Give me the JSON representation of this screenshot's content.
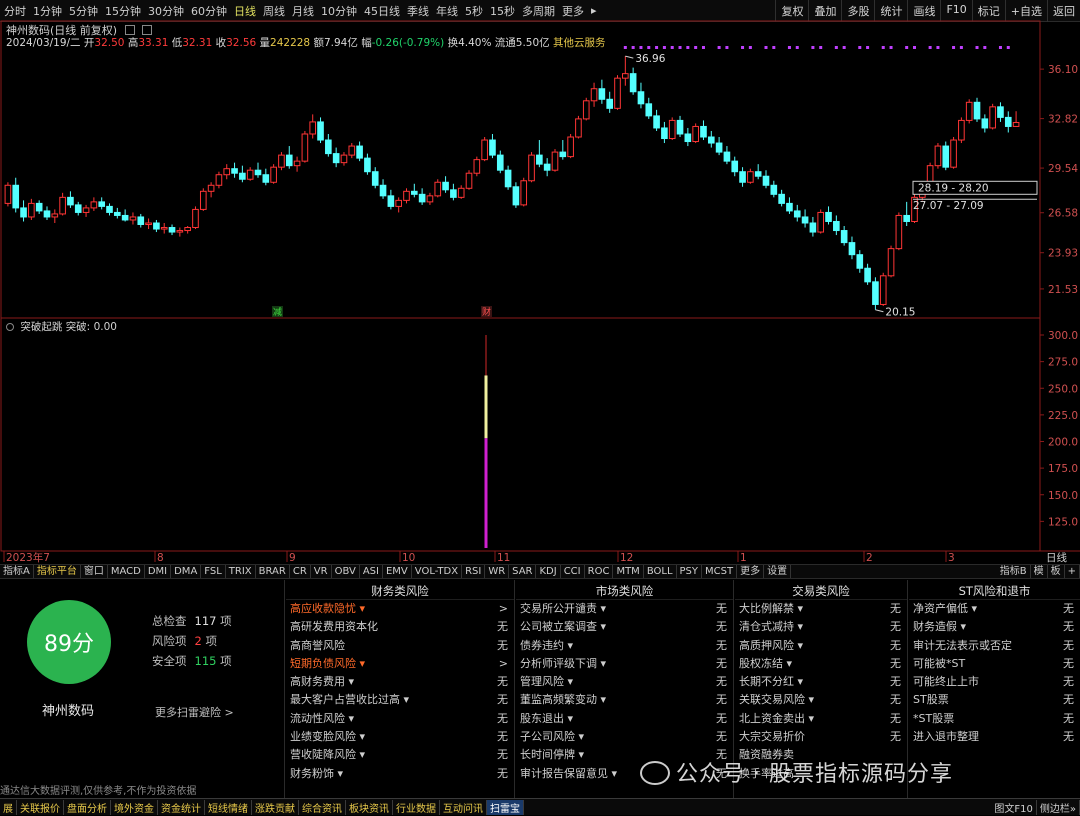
{
  "toolbar": {
    "periods": [
      "分时",
      "1分钟",
      "5分钟",
      "15分钟",
      "30分钟",
      "60分钟",
      "日线",
      "周线",
      "月线",
      "10分钟",
      "45日线",
      "季线",
      "年线",
      "5秒",
      "15秒",
      "多周期",
      "更多"
    ],
    "active_period": "日线",
    "right_tools": [
      "复权",
      "叠加",
      "多股",
      "统计",
      "画线",
      "F10",
      "标记",
      "+自选",
      "返回"
    ]
  },
  "stock": {
    "title": "神州数码(日线 前复权)",
    "date": "2024/03/19/二",
    "open_label": "开",
    "open": "32.50",
    "high_label": "高",
    "high": "33.31",
    "low_label": "低",
    "low": "32.31",
    "close_label": "收",
    "close": "32.56",
    "vol_label": "量",
    "volume": "242228",
    "amount_label": "额",
    "amount": "7.94亿",
    "change_label": "幅",
    "change": "-0.26(-0.79%)",
    "turnover_label": "换",
    "turnover": "4.40%",
    "float_label": "流通",
    "float_cap": "5.50亿",
    "concept": "其他云服务"
  },
  "price_axis": [
    "36.10",
    "32.82",
    "29.54",
    "26.58",
    "23.93",
    "21.53"
  ],
  "annotations": {
    "high": "36.96",
    "low": "20.15",
    "box1": "28.19 - 28.20",
    "box2": "27.07 - 27.09",
    "tag_jian": "减",
    "tag_cai": "财"
  },
  "sub_indicator": {
    "name": "突破起跳",
    "value_label": "突破: 0.00"
  },
  "sub_axis": [
    "300.0",
    "275.0",
    "250.0",
    "225.0",
    "200.0",
    "175.0",
    "150.0",
    "125.0"
  ],
  "time_axis": [
    "2023年7",
    "8",
    "9",
    "10",
    "11",
    "12",
    "1",
    "2",
    "3"
  ],
  "time_axis_right": "日线",
  "indicator_tabs": [
    "指标A",
    "指标平台",
    "窗口",
    "MACD",
    "DMI",
    "DMA",
    "FSL",
    "TRIX",
    "BRAR",
    "CR",
    "VR",
    "OBV",
    "ASI",
    "EMV",
    "VOL-TDX",
    "RSI",
    "WR",
    "SAR",
    "KDJ",
    "CCI",
    "ROC",
    "MTM",
    "BOLL",
    "PSY",
    "MCST",
    "更多",
    "设置"
  ],
  "indicator_tabs_right": [
    "指标B",
    "模",
    "板",
    "+"
  ],
  "risk": {
    "score": "89分",
    "stock_name": "神州数码",
    "total_label": "总检查",
    "total": "117",
    "unit": "项",
    "risk_label": "风险项",
    "risk_count": "2",
    "safe_label": "安全项",
    "safe_count": "115",
    "more_scan": "更多扫雷避险 >",
    "disclaimer": "通达信大数据评测,仅供参考,不作为投资依据",
    "columns": [
      {
        "title": "财务类风险",
        "rows": [
          {
            "label": "高应收款隐忧 ▾",
            "value": ">",
            "hot": true
          },
          {
            "label": "高研发费用资本化",
            "value": "无"
          },
          {
            "label": "高商誉风险",
            "value": "无"
          },
          {
            "label": "短期负债风险 ▾",
            "value": ">",
            "hot": true
          },
          {
            "label": "高财务费用 ▾",
            "value": "无"
          },
          {
            "label": "最大客户占营收比过高 ▾",
            "value": "无"
          },
          {
            "label": "流动性风险 ▾",
            "value": "无"
          },
          {
            "label": "业绩变脸风险 ▾",
            "value": "无"
          },
          {
            "label": "营收陡降风险 ▾",
            "value": "无"
          },
          {
            "label": "财务粉饰 ▾",
            "value": "无"
          }
        ]
      },
      {
        "title": "市场类风险",
        "rows": [
          {
            "label": "交易所公开谴责 ▾",
            "value": "无"
          },
          {
            "label": "公司被立案调查 ▾",
            "value": "无"
          },
          {
            "label": "债券违约 ▾",
            "value": "无"
          },
          {
            "label": "分析师评级下调 ▾",
            "value": "无"
          },
          {
            "label": "管理风险 ▾",
            "value": "无"
          },
          {
            "label": "董监高频繁变动 ▾",
            "value": "无"
          },
          {
            "label": "股东退出 ▾",
            "value": "无"
          },
          {
            "label": "子公司风险 ▾",
            "value": "无"
          },
          {
            "label": "长时间停牌 ▾",
            "value": "无"
          },
          {
            "label": "审计报告保留意见 ▾",
            "value": "无"
          }
        ]
      },
      {
        "title": "交易类风险",
        "rows": [
          {
            "label": "大比例解禁 ▾",
            "value": "无"
          },
          {
            "label": "清仓式减持 ▾",
            "value": "无"
          },
          {
            "label": "高质押风险 ▾",
            "value": "无"
          },
          {
            "label": "股权冻结 ▾",
            "value": "无"
          },
          {
            "label": "长期不分红 ▾",
            "value": "无"
          },
          {
            "label": "关联交易风险 ▾",
            "value": "无"
          },
          {
            "label": "北上资金卖出 ▾",
            "value": "无"
          },
          {
            "label": "大宗交易折价",
            "value": "无"
          },
          {
            "label": "融资融券卖",
            "value": ""
          },
          {
            "label": "换手率过高",
            "value": ""
          }
        ]
      },
      {
        "title": "ST风险和退市",
        "rows": [
          {
            "label": "净资产偏低 ▾",
            "value": "无"
          },
          {
            "label": "财务造假 ▾",
            "value": "无"
          },
          {
            "label": "审计无法表示或否定",
            "value": "无"
          },
          {
            "label": "可能被*ST",
            "value": "无"
          },
          {
            "label": "可能终止上市",
            "value": "无"
          },
          {
            "label": "ST股票",
            "value": "无"
          },
          {
            "label": "*ST股票",
            "value": "无"
          },
          {
            "label": "进入退市整理",
            "value": "无"
          }
        ]
      }
    ]
  },
  "watermark": "公众号 · 股票指标源码分享",
  "bottom_tabs": [
    "展",
    "关联报价",
    "盘面分析",
    "境外资金",
    "资金统计",
    "短线情绪",
    "涨跌贡献",
    "综合资讯",
    "板块资讯",
    "行业数据",
    "互动问讯",
    "扫雷宝"
  ],
  "bottom_selected": "扫雷宝",
  "bottom_right": [
    "图文F10",
    "侧边栏»"
  ],
  "chart_data": {
    "type": "candlestick",
    "y_range": [
      20.0,
      37.5
    ],
    "candles": [
      [
        27.2,
        28.6,
        27.0,
        28.4
      ],
      [
        28.4,
        28.9,
        26.6,
        26.9
      ],
      [
        26.9,
        27.4,
        26.0,
        26.3
      ],
      [
        26.3,
        27.5,
        26.1,
        27.2
      ],
      [
        27.2,
        27.4,
        26.5,
        26.7
      ],
      [
        26.7,
        27.0,
        26.1,
        26.3
      ],
      [
        26.3,
        26.8,
        25.9,
        26.5
      ],
      [
        26.5,
        27.9,
        26.4,
        27.6
      ],
      [
        27.6,
        28.0,
        26.9,
        27.1
      ],
      [
        27.1,
        27.3,
        26.4,
        26.6
      ],
      [
        26.6,
        27.1,
        26.3,
        26.9
      ],
      [
        26.9,
        27.6,
        26.7,
        27.3
      ],
      [
        27.3,
        27.6,
        26.8,
        27.0
      ],
      [
        27.0,
        27.2,
        26.4,
        26.6
      ],
      [
        26.6,
        26.9,
        26.2,
        26.4
      ],
      [
        26.4,
        26.8,
        26.0,
        26.1
      ],
      [
        26.1,
        26.6,
        25.8,
        26.3
      ],
      [
        26.3,
        26.5,
        25.6,
        25.8
      ],
      [
        25.8,
        26.2,
        25.5,
        25.9
      ],
      [
        25.9,
        26.1,
        25.3,
        25.5
      ],
      [
        25.5,
        25.9,
        25.2,
        25.6
      ],
      [
        25.6,
        25.8,
        25.1,
        25.3
      ],
      [
        25.3,
        25.6,
        25.0,
        25.4
      ],
      [
        25.4,
        25.7,
        25.2,
        25.6
      ],
      [
        25.6,
        27.0,
        25.5,
        26.8
      ],
      [
        26.8,
        28.2,
        26.7,
        28.0
      ],
      [
        28.0,
        28.6,
        27.6,
        28.4
      ],
      [
        28.4,
        29.3,
        28.2,
        29.1
      ],
      [
        29.1,
        29.8,
        28.8,
        29.5
      ],
      [
        29.5,
        29.9,
        28.9,
        29.2
      ],
      [
        29.2,
        29.7,
        28.6,
        28.8
      ],
      [
        28.8,
        29.6,
        28.7,
        29.4
      ],
      [
        29.4,
        29.9,
        28.9,
        29.1
      ],
      [
        29.1,
        29.5,
        28.4,
        28.6
      ],
      [
        28.6,
        29.8,
        28.5,
        29.6
      ],
      [
        29.6,
        30.6,
        29.4,
        30.4
      ],
      [
        30.4,
        31.0,
        29.5,
        29.7
      ],
      [
        29.7,
        30.3,
        29.3,
        30.0
      ],
      [
        30.0,
        32.0,
        29.9,
        31.8
      ],
      [
        31.8,
        33.1,
        31.5,
        32.6
      ],
      [
        32.6,
        32.9,
        31.2,
        31.4
      ],
      [
        31.4,
        31.8,
        30.3,
        30.5
      ],
      [
        30.5,
        30.9,
        29.6,
        29.9
      ],
      [
        29.9,
        30.6,
        29.7,
        30.4
      ],
      [
        30.4,
        31.2,
        30.2,
        31.0
      ],
      [
        31.0,
        31.3,
        30.0,
        30.2
      ],
      [
        30.2,
        30.5,
        29.1,
        29.3
      ],
      [
        29.3,
        29.6,
        28.2,
        28.4
      ],
      [
        28.4,
        28.8,
        27.5,
        27.7
      ],
      [
        27.7,
        28.1,
        26.8,
        27.0
      ],
      [
        27.0,
        27.6,
        26.6,
        27.4
      ],
      [
        27.4,
        28.2,
        27.2,
        28.0
      ],
      [
        28.0,
        28.5,
        27.6,
        27.8
      ],
      [
        27.8,
        28.2,
        27.1,
        27.3
      ],
      [
        27.3,
        27.9,
        27.1,
        27.7
      ],
      [
        27.7,
        28.8,
        27.6,
        28.6
      ],
      [
        28.6,
        29.0,
        27.9,
        28.1
      ],
      [
        28.1,
        28.5,
        27.4,
        27.6
      ],
      [
        27.6,
        28.4,
        27.5,
        28.2
      ],
      [
        28.2,
        29.4,
        28.1,
        29.2
      ],
      [
        29.2,
        30.3,
        29.0,
        30.1
      ],
      [
        30.1,
        31.6,
        30.0,
        31.4
      ],
      [
        31.4,
        31.8,
        30.2,
        30.4
      ],
      [
        30.4,
        30.7,
        29.2,
        29.4
      ],
      [
        29.4,
        29.7,
        28.1,
        28.3
      ],
      [
        28.3,
        28.6,
        26.9,
        27.1
      ],
      [
        27.1,
        28.9,
        27.0,
        28.7
      ],
      [
        28.7,
        30.6,
        28.6,
        30.4
      ],
      [
        30.4,
        31.4,
        29.6,
        29.8
      ],
      [
        29.8,
        30.2,
        29.0,
        29.4
      ],
      [
        29.4,
        30.8,
        29.3,
        30.6
      ],
      [
        30.6,
        31.4,
        30.1,
        30.3
      ],
      [
        30.3,
        31.8,
        30.2,
        31.6
      ],
      [
        31.6,
        33.0,
        31.5,
        32.8
      ],
      [
        32.8,
        34.2,
        32.7,
        34.0
      ],
      [
        34.0,
        35.2,
        33.6,
        34.8
      ],
      [
        34.8,
        35.4,
        33.8,
        34.1
      ],
      [
        34.1,
        34.6,
        33.2,
        33.5
      ],
      [
        33.5,
        35.7,
        33.4,
        35.5
      ],
      [
        35.5,
        36.96,
        35.0,
        35.8
      ],
      [
        35.8,
        36.2,
        34.4,
        34.6
      ],
      [
        34.6,
        35.2,
        33.5,
        33.8
      ],
      [
        33.8,
        34.2,
        32.8,
        33.0
      ],
      [
        33.0,
        33.4,
        32.0,
        32.2
      ],
      [
        32.2,
        32.6,
        31.2,
        31.5
      ],
      [
        31.5,
        32.9,
        31.4,
        32.7
      ],
      [
        32.7,
        33.0,
        31.6,
        31.8
      ],
      [
        31.8,
        32.2,
        31.0,
        31.3
      ],
      [
        31.3,
        32.5,
        31.2,
        32.3
      ],
      [
        32.3,
        32.7,
        31.4,
        31.6
      ],
      [
        31.6,
        32.0,
        30.9,
        31.2
      ],
      [
        31.2,
        31.6,
        30.4,
        30.6
      ],
      [
        30.6,
        31.0,
        29.8,
        30.0
      ],
      [
        30.0,
        30.3,
        29.0,
        29.3
      ],
      [
        29.3,
        29.6,
        28.3,
        28.6
      ],
      [
        28.6,
        29.5,
        28.5,
        29.3
      ],
      [
        29.3,
        29.8,
        28.8,
        29.0
      ],
      [
        29.0,
        29.4,
        28.2,
        28.4
      ],
      [
        28.4,
        28.7,
        27.6,
        27.8
      ],
      [
        27.8,
        28.1,
        27.0,
        27.2
      ],
      [
        27.2,
        27.6,
        26.5,
        26.7
      ],
      [
        26.7,
        27.1,
        26.0,
        26.3
      ],
      [
        26.3,
        26.8,
        25.6,
        25.9
      ],
      [
        25.9,
        26.3,
        25.0,
        25.3
      ],
      [
        25.3,
        26.8,
        25.2,
        26.6
      ],
      [
        26.6,
        27.0,
        25.8,
        26.0
      ],
      [
        26.0,
        26.4,
        25.1,
        25.4
      ],
      [
        25.4,
        25.7,
        24.4,
        24.6
      ],
      [
        24.6,
        25.0,
        23.5,
        23.8
      ],
      [
        23.8,
        24.1,
        22.6,
        22.9
      ],
      [
        22.9,
        23.2,
        21.8,
        22.0
      ],
      [
        22.0,
        22.3,
        20.15,
        20.5
      ],
      [
        20.5,
        22.6,
        20.4,
        22.4
      ],
      [
        22.4,
        24.4,
        22.3,
        24.2
      ],
      [
        24.2,
        26.6,
        24.1,
        26.4
      ],
      [
        26.4,
        27.3,
        25.7,
        26.0
      ],
      [
        26.0,
        27.8,
        25.9,
        27.6
      ],
      [
        27.6,
        28.4,
        27.4,
        28.2
      ],
      [
        28.2,
        29.9,
        28.1,
        29.7
      ],
      [
        29.7,
        31.2,
        29.5,
        31.0
      ],
      [
        31.0,
        31.3,
        29.4,
        29.6
      ],
      [
        29.6,
        31.6,
        29.5,
        31.4
      ],
      [
        31.4,
        32.9,
        31.2,
        32.7
      ],
      [
        32.7,
        34.1,
        32.5,
        33.9
      ],
      [
        33.9,
        34.2,
        32.6,
        32.8
      ],
      [
        32.8,
        33.1,
        31.9,
        32.2
      ],
      [
        32.2,
        33.8,
        32.1,
        33.6
      ],
      [
        33.6,
        33.9,
        32.6,
        32.9
      ],
      [
        32.9,
        33.3,
        31.9,
        32.3
      ],
      [
        32.3,
        33.31,
        32.31,
        32.56
      ]
    ]
  }
}
